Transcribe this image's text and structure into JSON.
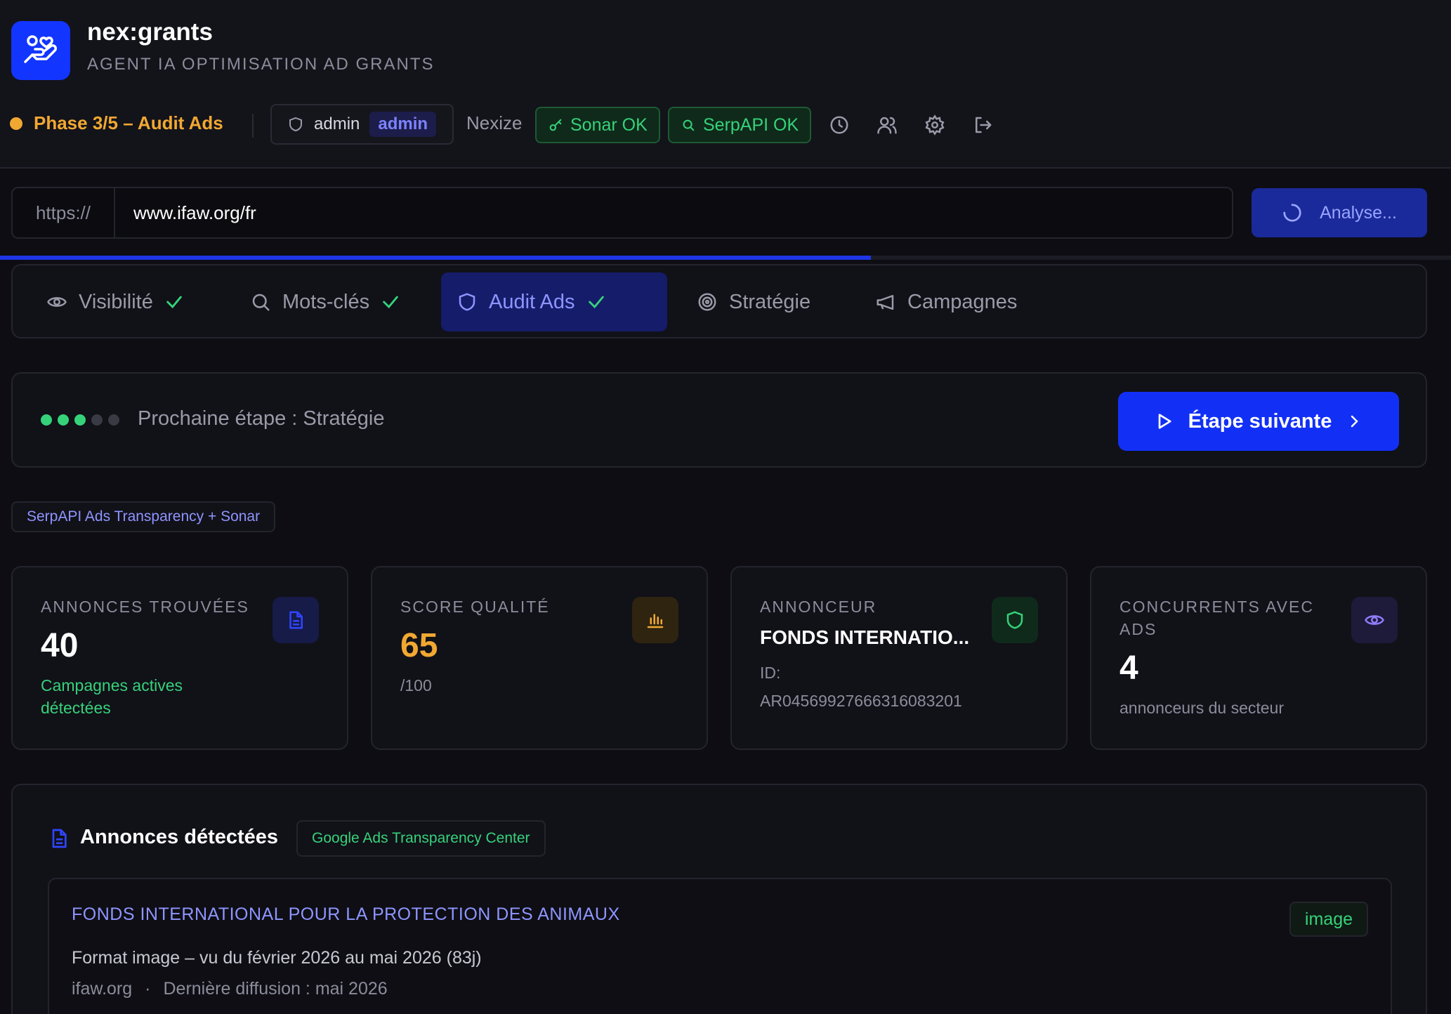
{
  "app": {
    "title": "nex:grants",
    "subtitle": "AGENT IA OPTIMISATION AD GRANTS",
    "phase": "Phase 3/5 – Audit Ads",
    "user_name": "admin",
    "user_role": "admin",
    "org": "Nexize",
    "status": [
      {
        "label": "Sonar OK",
        "icon": "key-icon"
      },
      {
        "label": "SerpAPI OK",
        "icon": "search-icon"
      }
    ],
    "toolbar_icons": [
      "history-icon",
      "users-icon",
      "settings-icon",
      "logout-icon"
    ]
  },
  "url_bar": {
    "prefix": "https://",
    "value": "www.ifaw.org/fr",
    "analyse_label": "Analyse...",
    "progress": 0.6
  },
  "tabs": [
    {
      "label": "Visibilité",
      "icon": "eye-icon",
      "done": true,
      "active": false
    },
    {
      "label": "Mots-clés",
      "icon": "search-icon",
      "done": true,
      "active": false
    },
    {
      "label": "Audit Ads",
      "icon": "shield-icon",
      "done": true,
      "active": true
    },
    {
      "label": "Stratégie",
      "icon": "target-icon",
      "done": false,
      "active": false
    },
    {
      "label": "Campagnes",
      "icon": "megaphone-icon",
      "done": false,
      "active": false
    }
  ],
  "next_step": {
    "steps_done": 3,
    "steps_total": 5,
    "text": "Prochaine étape : Stratégie",
    "button_label": "Étape suivante"
  },
  "source_badge": "SerpAPI Ads Transparency + Sonar",
  "stats": {
    "ads": {
      "label": "ANNONCES TROUVÉES",
      "value": "40",
      "sub_line1": "Campagnes actives",
      "sub_line2": "détectées"
    },
    "score": {
      "label": "SCORE QUALITÉ",
      "value": "65",
      "sub": "/100"
    },
    "advertiser": {
      "label": "ANNONCEUR",
      "value": "FONDS INTERNATIO...",
      "id_label": "ID:",
      "id_value": "AR04569927666316083201"
    },
    "competitors": {
      "label_line1": "CONCURRENTS AVEC",
      "label_line2": "ADS",
      "value": "4",
      "sub": "annonceurs du secteur"
    }
  },
  "colors": {
    "accent": "#1230f5",
    "green": "#36d27a",
    "orange": "#f1a832",
    "purple": "#8e95ff"
  },
  "ads_section": {
    "title": "Annonces détectées",
    "source": "Google Ads Transparency Center",
    "items": [
      {
        "name": "FONDS INTERNATIONAL POUR LA PROTECTION DES ANIMAUX",
        "type": "image",
        "format": "Format image – vu du février 2026 au mai 2026 (83j)",
        "domain": "ifaw.org",
        "separator": "·",
        "last_seen": "Dernière diffusion : mai 2026"
      }
    ]
  }
}
